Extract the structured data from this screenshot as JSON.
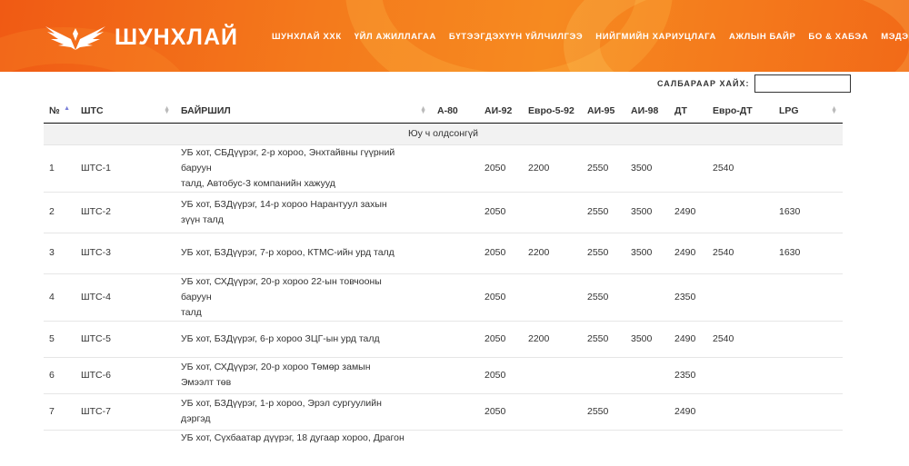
{
  "brand": {
    "name": "ШУНХЛАЙ"
  },
  "nav": [
    "ШУНХЛАЙ ХХК",
    "ҮЙЛ АЖИЛЛАГАА",
    "БҮТЭЭГДЭХҮҮН ҮЙЛЧИЛГЭЭ",
    "НИЙГМИЙН ХАРИУЦЛАГА",
    "АЖЛЫН БАЙР",
    "БО & ХАБЭА",
    "МЭДЭЭ"
  ],
  "search": {
    "label": "САЛБАРААР ХАЙХ:",
    "value": ""
  },
  "table": {
    "columns": [
      "№",
      "ШТС",
      "БАЙРШИЛ",
      "А-80",
      "АИ-92",
      "Евро-5-92",
      "АИ-95",
      "АИ-98",
      "ДТ",
      "Евро-ДТ",
      "LPG"
    ],
    "empty_message": "Юу ч олдсонгүй",
    "rows": [
      {
        "no": "1",
        "station": "ШТС-1",
        "address": [
          "УБ хот, СБДүүрэг, 2-р хороо, Энхтайвны гүүрний баруун",
          "талд, Автобус-3 компанийн хажууд"
        ],
        "a80": "",
        "ai92": "2050",
        "euro592": "2200",
        "ai95": "2550",
        "ai98": "3500",
        "dt": "",
        "eurodt": "2540",
        "lpg": ""
      },
      {
        "no": "2",
        "station": "ШТС-2",
        "address": [
          "УБ хот, БЗДүүрэг, 14-р хороо Нарантуул захын зүүн талд"
        ],
        "a80": "",
        "ai92": "2050",
        "euro592": "",
        "ai95": "2550",
        "ai98": "3500",
        "dt": "2490",
        "eurodt": "",
        "lpg": "1630"
      },
      {
        "no": "3",
        "station": "ШТС-3",
        "address": [
          "УБ хот, БЗДүүрэг, 7-р хороо, КТМС-ийн урд талд"
        ],
        "a80": "",
        "ai92": "2050",
        "euro592": "2200",
        "ai95": "2550",
        "ai98": "3500",
        "dt": "2490",
        "eurodt": "2540",
        "lpg": "1630"
      },
      {
        "no": "4",
        "station": "ШТС-4",
        "address": [
          "УБ хот, СХДүүрэг, 20-р хороо 22-ын товчооны баруун",
          "талд"
        ],
        "a80": "",
        "ai92": "2050",
        "euro592": "",
        "ai95": "2550",
        "ai98": "",
        "dt": "2350",
        "eurodt": "",
        "lpg": ""
      },
      {
        "no": "5",
        "station": "ШТС-5",
        "address": [
          "УБ хот, БЗДүүрэг, 6-р хороо ЗЦГ-ын урд талд"
        ],
        "a80": "",
        "ai92": "2050",
        "euro592": "2200",
        "ai95": "2550",
        "ai98": "3500",
        "dt": "2490",
        "eurodt": "2540",
        "lpg": ""
      },
      {
        "no": "6",
        "station": "ШТС-6",
        "address": [
          "УБ хот, СХДүүрэг, 20-р хороо Төмөр замын Эмээлт төв"
        ],
        "a80": "",
        "ai92": "2050",
        "euro592": "",
        "ai95": "",
        "ai98": "",
        "dt": "2350",
        "eurodt": "",
        "lpg": ""
      },
      {
        "no": "7",
        "station": "ШТС-7",
        "address": [
          "УБ хот, БЗДүүрэг, 1-р хороо, Эрэл сургуулийн дэргэд"
        ],
        "a80": "",
        "ai92": "2050",
        "euro592": "",
        "ai95": "2550",
        "ai98": "",
        "dt": "2490",
        "eurodt": "",
        "lpg": ""
      },
      {
        "no": "",
        "station": "",
        "address": [
          "УБ хот, Сүхбаатар дүүрэг, 18 дугаар хороо, Драгон"
        ],
        "a80": "",
        "ai92": "",
        "euro592": "",
        "ai95": "",
        "ai98": "",
        "dt": "",
        "eurodt": "",
        "lpg": ""
      }
    ]
  }
}
